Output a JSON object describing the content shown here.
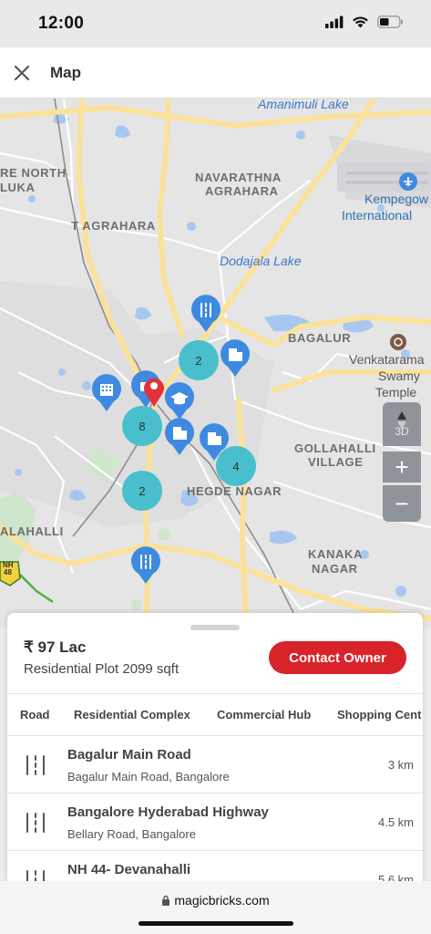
{
  "status_bar": {
    "time": "12:00"
  },
  "header": {
    "title": "Map"
  },
  "map": {
    "labels": {
      "amanimuli_lake": "Amanimuli Lake",
      "re_north": "RE NORTH",
      "luka": "LUKA",
      "navarathna": "NAVARATHNA",
      "agrahara": "AGRAHARA",
      "kempegowda": "Kempegow",
      "international": "International",
      "t_agrahara": "T AGRAHARA",
      "dodajala_lake": "Dodajala Lake",
      "bagalur": "BAGALUR",
      "venkatarama_1": "Venkatarama",
      "venkatarama_2": "Swamy",
      "venkatarama_3": "Temple",
      "gollahalli": "GOLLAHALLI",
      "village": "VILLAGE",
      "hegde_nagar": "HEGDE NAGAR",
      "alahalli": "ALAHALLI",
      "kanaka": "KANAKA",
      "nagar": "NAGAR",
      "nh48_1": "NH",
      "nh48_2": "48"
    },
    "clusters": [
      "2",
      "8",
      "4",
      "2"
    ],
    "controls": {
      "three_d": "3D",
      "zoom_in": "+",
      "zoom_out": "−"
    },
    "colors": {
      "cluster": "#49bfcd",
      "pin": "#3e8ae0",
      "property_pin": "#e0333a"
    }
  },
  "sheet": {
    "price": "₹ 97 Lac",
    "property": "Residential Plot 2099 sqft",
    "contact_button": "Contact Owner",
    "tabs": [
      "Road",
      "Residential Complex",
      "Commercial Hub",
      "Shopping Cent"
    ],
    "rows": [
      {
        "name": "Bagalur Main Road",
        "address": "Bagalur Main Road, Bangalore",
        "distance": "3 km"
      },
      {
        "name": "Bangalore Hyderabad Highway",
        "address": "Bellary Road, Bangalore",
        "distance": "4.5 km"
      },
      {
        "name": "NH 44- Devanahalli",
        "address": "",
        "distance": "5.6 km"
      }
    ],
    "accent": "#d8232a"
  },
  "browser": {
    "url": "magicbricks.com"
  }
}
